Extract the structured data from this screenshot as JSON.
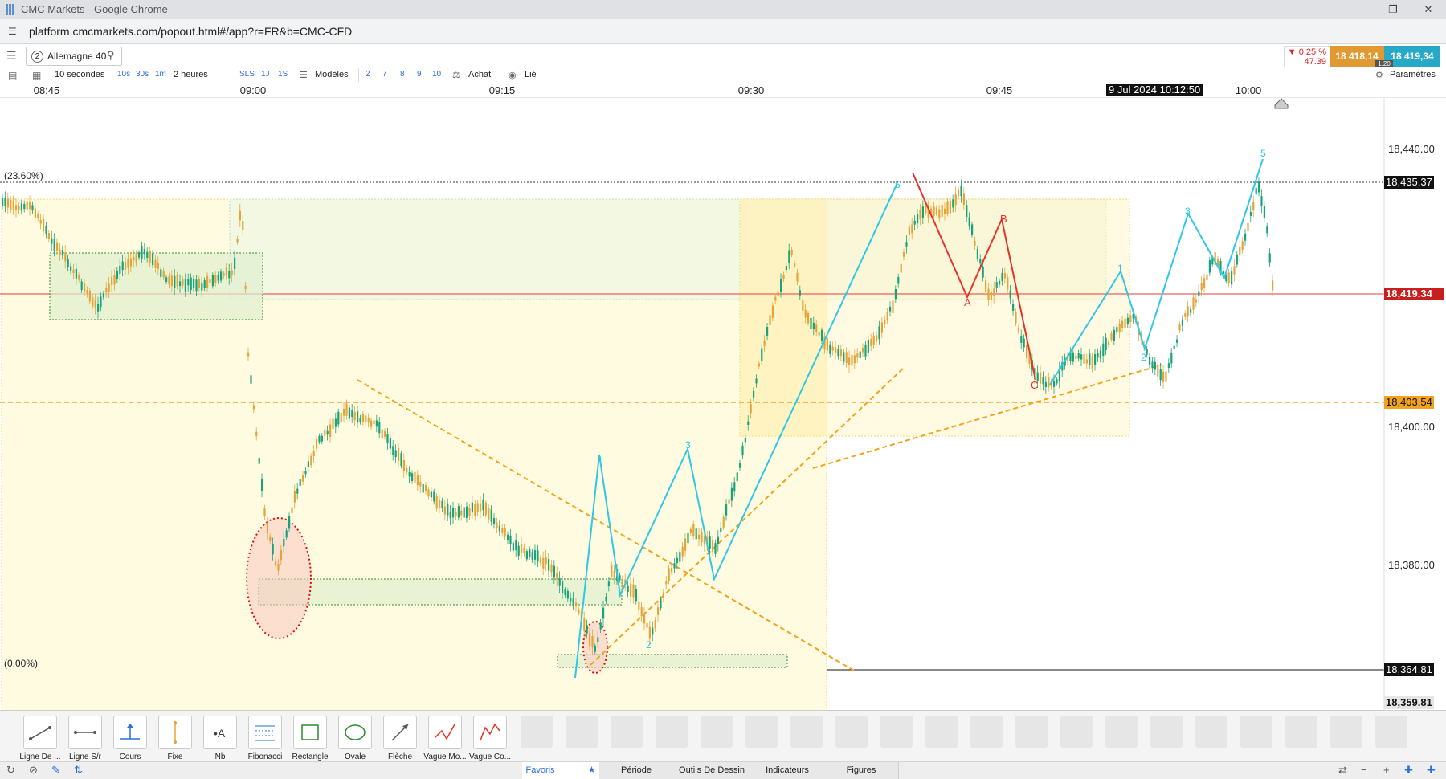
{
  "browser": {
    "title": "CMC Markets - Google Chrome",
    "url": "platform.cmcmarkets.com/popout.html#/app?r=FR&b=CMC-CFD"
  },
  "instrument": {
    "index": "2",
    "name": "Allemagne 40"
  },
  "quote": {
    "change_pct": "▼ 0,25 %",
    "change_abs": "47.39",
    "sell": "18 418,14",
    "buy": "18 419,34",
    "spread": "1.20",
    "sell_color": "#e09a31",
    "buy_color": "#26a8c9",
    "down_color": "#dd2222"
  },
  "toolbar": {
    "interval": "10 secondes",
    "interval_quick": [
      "10s",
      "30s",
      "1m"
    ],
    "period": "2 heures",
    "period_quick": [
      "SLS",
      "1J",
      "1S"
    ],
    "templates": "Modèles",
    "template_quick": [
      "2",
      "7",
      "8",
      "9",
      "10"
    ],
    "buy_label": "Achat",
    "link_label": "Lié",
    "settings_label": "Paramètres"
  },
  "xaxis": {
    "ticks": [
      "08:45",
      "09:00",
      "09:15",
      "09:30",
      "09:45",
      "10:00"
    ],
    "cursor_label": "9 Jul 2024 10:12:50"
  },
  "chart_data": {
    "type": "candlestick",
    "title": "",
    "yticks": [
      "18,440.00",
      "18,400.00",
      "18,380.00"
    ],
    "price_tags": [
      {
        "label": "18,435.37",
        "value": 18435.37,
        "style": "fib-23.6"
      },
      {
        "label": "18,419.34",
        "value": 18419.34,
        "style": "current"
      },
      {
        "label": "18,403.54",
        "value": 18403.54,
        "style": "support"
      },
      {
        "label": "18,364.81",
        "value": 18364.81,
        "style": "fib-0"
      },
      {
        "label": "18,359.81",
        "value": 18359.81,
        "style": "axis-bottom"
      }
    ],
    "fib_labels": [
      "(23.60%)",
      "(0.00%)"
    ],
    "wave_labels": {
      "impulse_1": [
        "1",
        "2",
        "3",
        "5"
      ],
      "correction": [
        "A",
        "B",
        "C"
      ],
      "impulse_2": [
        "1",
        "2",
        "3",
        "5"
      ]
    },
    "colors": {
      "up": "#1aa37a",
      "down": "#e3a53a",
      "impulse": "#2ec7e6",
      "correction": "#e8322a",
      "trend": "#f3a21b",
      "zone": "#fffbe0"
    }
  },
  "tools": [
    "Ligne De ...",
    "Ligne S/r",
    "Cours",
    "Fixe",
    "Nb",
    "Fibonacci",
    "Rectangle",
    "Ovale",
    "Flèche",
    "Vague Mo...",
    "Vague Co..."
  ],
  "tabs": [
    "Favoris",
    "Période",
    "Outils De Dessin",
    "Indicateurs",
    "Figures"
  ]
}
